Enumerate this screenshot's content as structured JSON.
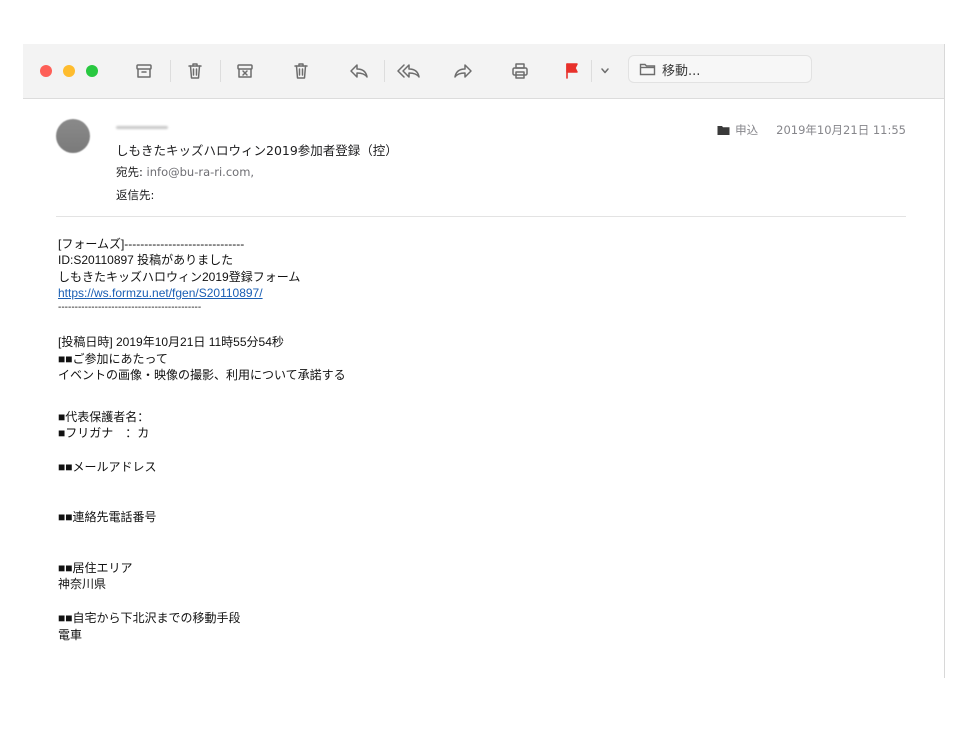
{
  "toolbar": {
    "traffic_colors": {
      "close": "#fe5f57",
      "minimize": "#febc2e",
      "zoom": "#28c840"
    },
    "flag_color": "#e8302a",
    "move_label": "移動..."
  },
  "message": {
    "subject": "しもきたキッズハロウィン2019参加者登録（控）",
    "to_label": "宛先:",
    "to_value": "info@bu-ra-ri.com,",
    "reply_to_label": "返信先:",
    "mailbox": "申込",
    "date": "2019年10月21日 11:55"
  },
  "body": {
    "l1": "[フォームズ]------------------------------",
    "l2": "ID:S20110897 投稿がありました",
    "l3": "しもきたキッズハロウィン2019登録フォーム",
    "link": "https://ws.formzu.net/fgen/S20110897/",
    "l4": "-------------------------------------------",
    "l5": "[投稿日時] 2019年10月21日 11時55分54秒",
    "l6": "■■ご参加にあたって",
    "l7": "イベントの画像・映像の撮影、利用について承諾する",
    "l8": "■代表保護者名：",
    "l9": "■フリガナ　：カ",
    "l10": "■■メールアドレス",
    "l11": "■■連絡先電話番号",
    "l12": "■■居住エリア",
    "l13": "神奈川県",
    "l14": "■■自宅から下北沢までの移動手段",
    "l15": "電車"
  }
}
